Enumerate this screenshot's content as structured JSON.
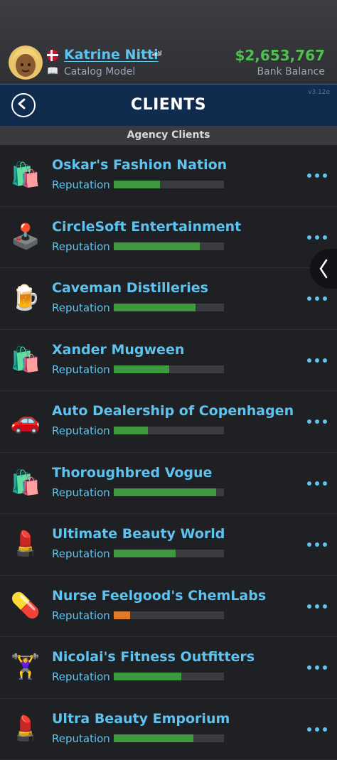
{
  "profile": {
    "name": "Katrine Nitti",
    "job": "Catalog Model",
    "balance": "$2,653,767",
    "balance_label": "Bank Balance",
    "flag": "denmark-flag",
    "badge_icon": "🏎"
  },
  "header": {
    "title": "CLIENTS",
    "version": "v3.12e"
  },
  "subheader": "Agency Clients",
  "colors": {
    "accent": "#5ec3ee",
    "good": "#3f9a3f",
    "warn": "#e07a2c",
    "header_bg": "#0f2c4e"
  },
  "clients": [
    {
      "name": "Oskar's Fashion Nation",
      "icon": "🛍️",
      "icon_name": "shopping-bags-icon",
      "reputation_label": "Reputation",
      "reputation": 0.42,
      "color": "#3f9a3f"
    },
    {
      "name": "CircleSoft Entertainment",
      "icon": "🕹️",
      "icon_name": "joystick-icon",
      "reputation_label": "Reputation",
      "reputation": 0.78,
      "color": "#3f9a3f"
    },
    {
      "name": "Caveman Distilleries",
      "icon": "🍺",
      "icon_name": "beer-mug-icon",
      "reputation_label": "Reputation",
      "reputation": 0.74,
      "color": "#3f9a3f"
    },
    {
      "name": "Xander Mugween",
      "icon": "🛍️",
      "icon_name": "shopping-bags-icon",
      "reputation_label": "Reputation",
      "reputation": 0.5,
      "color": "#3f9a3f"
    },
    {
      "name": "Auto Dealership of Copenhagen",
      "icon": "🚗",
      "icon_name": "car-icon",
      "reputation_label": "Reputation",
      "reputation": 0.31,
      "color": "#3f9a3f"
    },
    {
      "name": "Thoroughbred Vogue",
      "icon": "🛍️",
      "icon_name": "shopping-bags-icon",
      "reputation_label": "Reputation",
      "reputation": 0.93,
      "color": "#3f9a3f"
    },
    {
      "name": "Ultimate Beauty World",
      "icon": "💄",
      "icon_name": "lipstick-icon",
      "reputation_label": "Reputation",
      "reputation": 0.56,
      "color": "#3f9a3f"
    },
    {
      "name": "Nurse Feelgood's ChemLabs",
      "icon": "💊",
      "icon_name": "pill-icon",
      "reputation_label": "Reputation",
      "reputation": 0.15,
      "color": "#e07a2c"
    },
    {
      "name": "Nicolai's Fitness Outfitters",
      "icon": "🏋️‍♀️",
      "icon_name": "weightlifter-icon",
      "reputation_label": "Reputation",
      "reputation": 0.61,
      "color": "#3f9a3f"
    },
    {
      "name": "Ultra Beauty Emporium",
      "icon": "💄",
      "icon_name": "lipstick-icon",
      "reputation_label": "Reputation",
      "reputation": 0.72,
      "color": "#3f9a3f"
    }
  ]
}
